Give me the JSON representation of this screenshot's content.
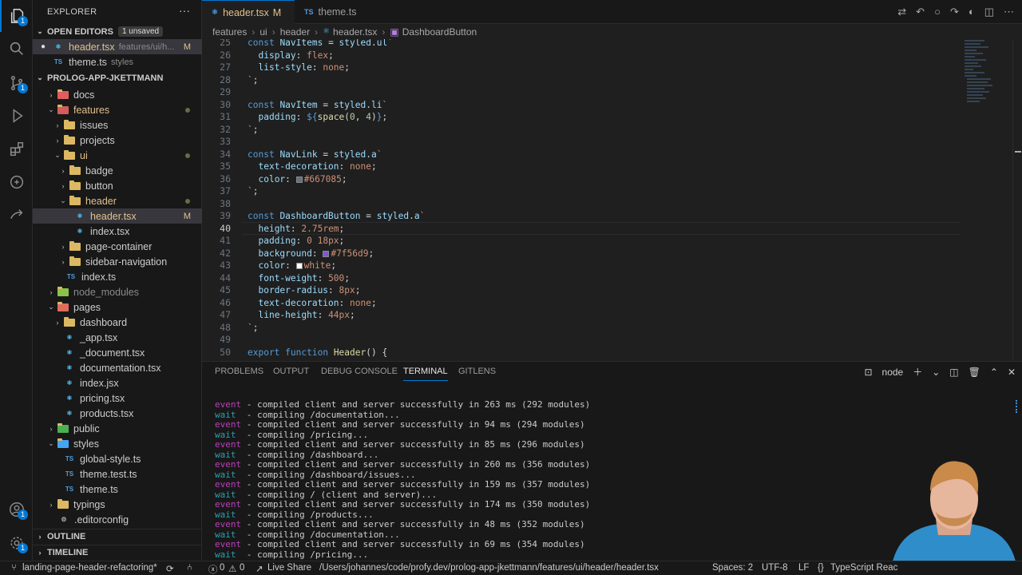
{
  "activity_bar": {
    "source_control_badge": "1",
    "accounts_badge": "1"
  },
  "sidebar": {
    "title": "EXPLORER",
    "more": "···",
    "open_editors": {
      "label": "OPEN EDITORS",
      "badge": "1 unsaved",
      "items": [
        {
          "name": "header.tsx",
          "path": "features/ui/h...",
          "status": "M"
        },
        {
          "name": "theme.ts",
          "path": "styles",
          "status": ""
        }
      ]
    },
    "project": {
      "label": "PROLOG-APP-JKETTMANN"
    },
    "tree": [
      {
        "label": "docs"
      },
      {
        "label": "features"
      },
      {
        "label": "issues"
      },
      {
        "label": "projects"
      },
      {
        "label": "ui"
      },
      {
        "label": "badge"
      },
      {
        "label": "button"
      },
      {
        "label": "header"
      },
      {
        "label": "header.tsx",
        "status": "M"
      },
      {
        "label": "index.tsx"
      },
      {
        "label": "page-container"
      },
      {
        "label": "sidebar-navigation"
      },
      {
        "label": "index.ts"
      },
      {
        "label": "node_modules"
      },
      {
        "label": "pages"
      },
      {
        "label": "dashboard"
      },
      {
        "label": "_app.tsx"
      },
      {
        "label": "_document.tsx"
      },
      {
        "label": "documentation.tsx"
      },
      {
        "label": "index.jsx"
      },
      {
        "label": "pricing.tsx"
      },
      {
        "label": "products.tsx"
      },
      {
        "label": "public"
      },
      {
        "label": "styles"
      },
      {
        "label": "global-style.ts"
      },
      {
        "label": "theme.test.ts"
      },
      {
        "label": "theme.ts"
      },
      {
        "label": "typings"
      },
      {
        "label": ".editorconfig"
      }
    ],
    "outline": "OUTLINE",
    "timeline": "TIMELINE"
  },
  "tabs": [
    {
      "label": "header.tsx",
      "status": "M"
    },
    {
      "label": "theme.ts"
    }
  ],
  "breadcrumb": [
    "features",
    "ui",
    "header",
    "header.tsx",
    "DashboardButton"
  ],
  "editor": {
    "line_numbers": [
      "25",
      "26",
      "27",
      "28",
      "29",
      "30",
      "31",
      "32",
      "33",
      "34",
      "35",
      "36",
      "37",
      "38",
      "39",
      "40",
      "41",
      "42",
      "43",
      "44",
      "45",
      "46",
      "47",
      "48",
      "49",
      "50"
    ],
    "swatches": {
      "gray": "#667085",
      "purple": "#7f56d9",
      "white": "#ffffff"
    }
  },
  "panel": {
    "tabs": [
      "PROBLEMS",
      "OUTPUT",
      "DEBUG CONSOLE",
      "TERMINAL",
      "GITLENS"
    ],
    "terminal_name": "node",
    "lines": [
      {
        "tag": "event",
        "text": "- compiled client and server successfully in 263 ms (292 modules)"
      },
      {
        "tag": "wait",
        "text": " - compiling /documentation..."
      },
      {
        "tag": "event",
        "text": "- compiled client and server successfully in 94 ms (294 modules)"
      },
      {
        "tag": "wait",
        "text": " - compiling /pricing..."
      },
      {
        "tag": "event",
        "text": "- compiled client and server successfully in 85 ms (296 modules)"
      },
      {
        "tag": "wait",
        "text": " - compiling /dashboard..."
      },
      {
        "tag": "event",
        "text": "- compiled client and server successfully in 260 ms (356 modules)"
      },
      {
        "tag": "wait",
        "text": " - compiling /dashboard/issues..."
      },
      {
        "tag": "event",
        "text": "- compiled client and server successfully in 159 ms (357 modules)"
      },
      {
        "tag": "wait",
        "text": " - compiling / (client and server)..."
      },
      {
        "tag": "event",
        "text": "- compiled client and server successfully in 174 ms (350 modules)"
      },
      {
        "tag": "wait",
        "text": " - compiling /products..."
      },
      {
        "tag": "event",
        "text": "- compiled client and server successfully in 48 ms (352 modules)"
      },
      {
        "tag": "wait",
        "text": " - compiling /documentation..."
      },
      {
        "tag": "event",
        "text": "- compiled client and server successfully in 69 ms (354 modules)"
      },
      {
        "tag": "wait",
        "text": " - compiling /pricing..."
      }
    ]
  },
  "status_bar": {
    "branch": "landing-page-header-refactoring*",
    "errors": "0",
    "warnings": "0",
    "live_share": "Live Share",
    "path": "/Users/johannes/code/profy.dev/prolog-app-jkettmann/features/ui/header/header.tsx",
    "spaces": "Spaces: 2",
    "encoding": "UTF-8",
    "eol": "LF",
    "braces": "{}",
    "language": "TypeScript Reac"
  }
}
